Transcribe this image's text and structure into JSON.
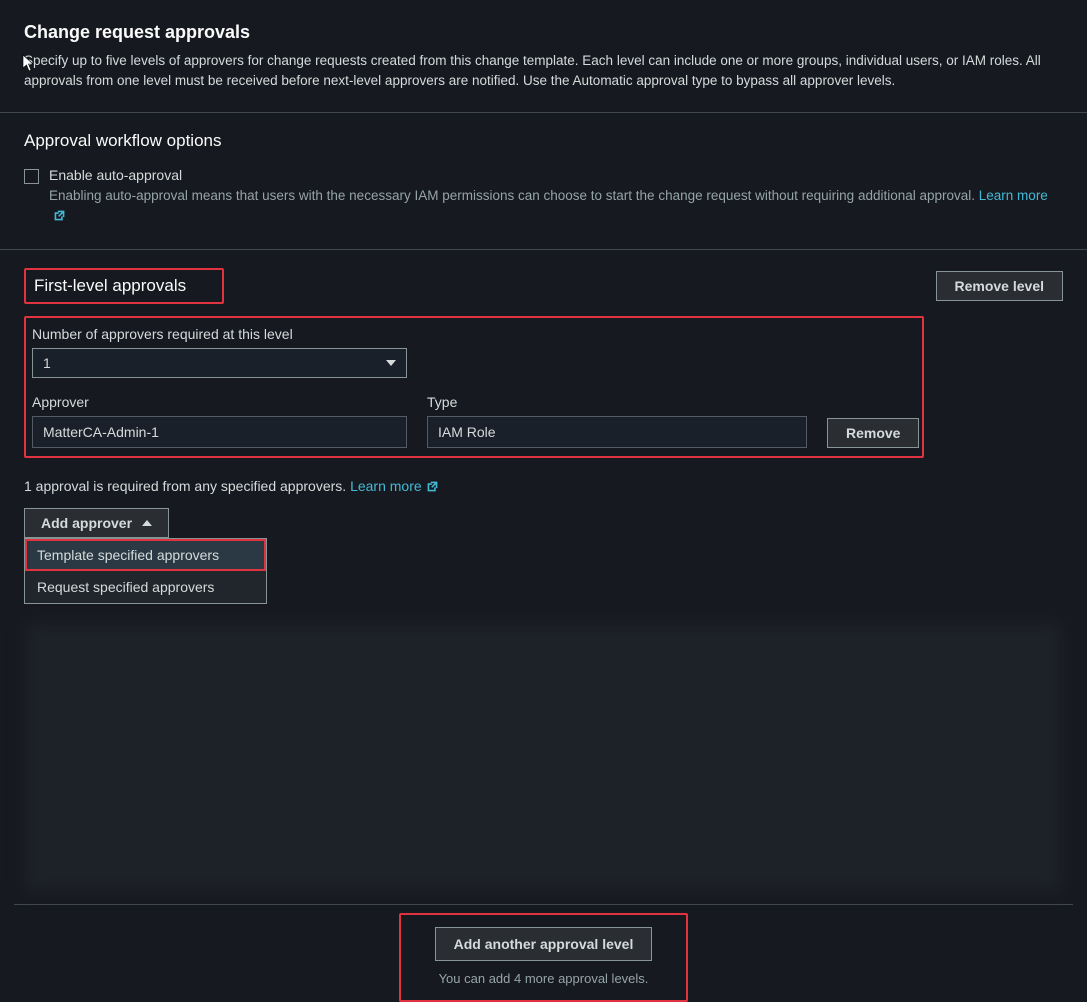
{
  "header": {
    "title": "Change request approvals",
    "description": "Specify up to five levels of approvers for change requests created from this change template. Each level can include one or more groups, individual users, or IAM roles. All approvals from one level must be received before next-level approvers are notified. Use the Automatic approval type to bypass all approver levels."
  },
  "workflow": {
    "heading": "Approval workflow options",
    "checkbox_label": "Enable auto-approval",
    "checkbox_desc": "Enabling auto-approval means that users with the necessary IAM permissions can choose to start the change request without requiring additional approval. ",
    "learn_more": "Learn more"
  },
  "level": {
    "title": "First-level approvals",
    "remove_level": "Remove level",
    "num_label": "Number of approvers required at this level",
    "num_value": "1",
    "approver_label": "Approver",
    "approver_value": "MatterCA-Admin-1",
    "type_label": "Type",
    "type_value": "IAM Role",
    "remove_btn": "Remove",
    "req_note": "1 approval is required from any specified approvers. ",
    "learn_more": "Learn more"
  },
  "add_approver": {
    "button": "Add approver",
    "options": [
      "Template specified approvers",
      "Request specified approvers"
    ]
  },
  "footer": {
    "add_level": "Add another approval level",
    "remaining": "You can add 4 more approval levels."
  }
}
